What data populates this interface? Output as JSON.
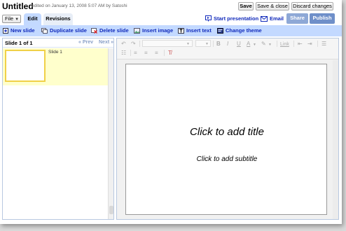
{
  "title": {
    "doc_name": "Untitled",
    "meta": "edited on January 13, 2008 5:07 AM by Satoshi",
    "save": "Save",
    "save_close": "Save & close",
    "discard": "Discard changes"
  },
  "tabs": {
    "file": "File",
    "edit": "Edit",
    "revisions": "Revisions",
    "start_presentation": "Start presentation",
    "email": "Email",
    "share": "Share",
    "publish": "Publish"
  },
  "actions": {
    "new_slide": "New slide",
    "duplicate_slide": "Duplicate slide",
    "delete_slide": "Delete slide",
    "insert_image": "Insert image",
    "insert_text": "Insert text",
    "change_theme": "Change theme"
  },
  "slides_panel": {
    "count": "Slide 1 of 1",
    "prev": "« Prev",
    "next": "Next »",
    "items": [
      {
        "label": "Slide 1"
      }
    ]
  },
  "format_toolbar": {
    "link": "Link"
  },
  "canvas": {
    "title_placeholder": "Click to add title",
    "subtitle_placeholder": "Click to add subtitle"
  },
  "colors": {
    "tab_active": "#c3d9ff",
    "link_blue": "#112abb",
    "selected_slide": "#ffffcc",
    "share_button": "#8ea8d6",
    "publish_button": "#6f8fc9"
  }
}
